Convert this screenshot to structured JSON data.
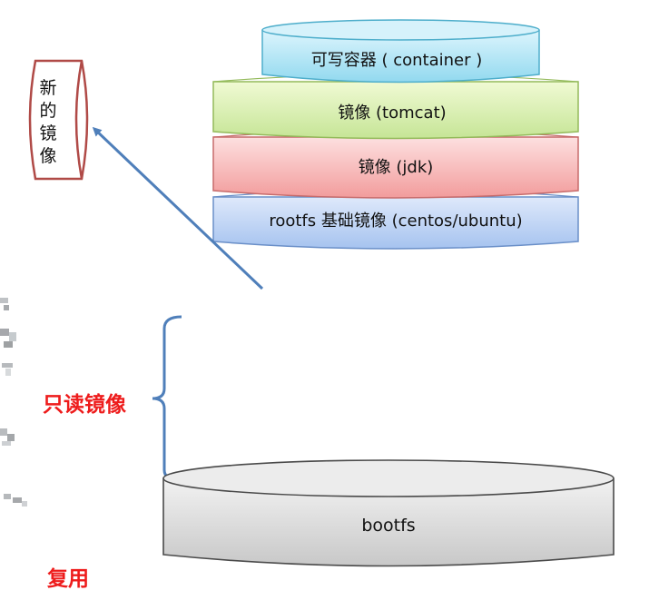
{
  "layers": [
    {
      "id": "container",
      "label": "可写容器 ( container )",
      "color": "#bde9f6"
    },
    {
      "id": "tomcat",
      "label": "镜像 (tomcat)",
      "color": "#e0f2b2"
    },
    {
      "id": "jdk",
      "label": "镜像 (jdk)",
      "color": "#f8bcbc"
    },
    {
      "id": "rootfs",
      "label": "rootfs 基础镜像 (centos/ubuntu)",
      "color": "#c4d8f6"
    }
  ],
  "bootfs": {
    "label": "bootfs",
    "color": "#d9d9d9"
  },
  "new_image": {
    "label": [
      "新",
      "的",
      "镜",
      "像"
    ],
    "stroke": "#b04a47"
  },
  "readonly_label": "只读镜像",
  "reuse_label": "复用",
  "colors": {
    "accent_red": "#ee1c1c",
    "arrow_blue": "#4f7fba"
  }
}
